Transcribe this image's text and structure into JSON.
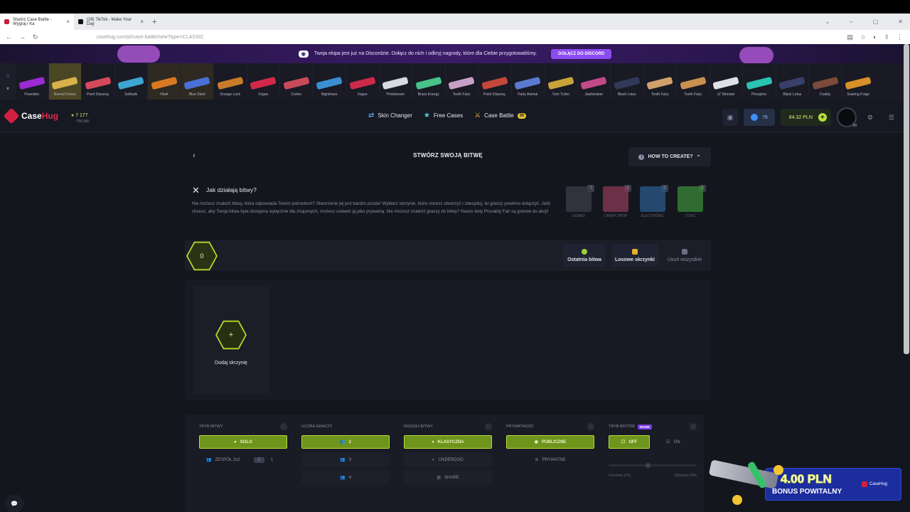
{
  "browser": {
    "tabs": [
      {
        "title": "Stwórz Case Battle - Wygraj i Ka"
      },
      {
        "title": "(28) TikTok - Make Your Day"
      }
    ],
    "new_tab": "+",
    "url": "casehug.com/pl/case-battle/new?type=CLASSIC"
  },
  "banner": {
    "text": "Twoja ekipa jest już na Discordzie. Dołącz do nich i odkryj nagrody, które dla Ciebie przygotowaliśmy.",
    "button": "DOŁĄCZ DO DISCORD"
  },
  "drops": [
    {
      "name": "Poseidon",
      "color": "#9b2ad1"
    },
    {
      "name": "Boreal Forest",
      "color": "#d7b24a"
    },
    {
      "name": "Point Disarray",
      "color": "#d44a5a"
    },
    {
      "name": "Solitude",
      "color": "#3fa5d2"
    },
    {
      "name": "Howl",
      "color": "#d97a22"
    },
    {
      "name": "Blue Steel",
      "color": "#4a6fd8"
    },
    {
      "name": "Orange Lock",
      "color": "#c87b2a"
    },
    {
      "name": "Vogue",
      "color": "#d2294b"
    },
    {
      "name": "Cortex",
      "color": "#c84a5a"
    },
    {
      "name": "Nightmare",
      "color": "#3a8fd2"
    },
    {
      "name": "Vogue",
      "color": "#cc2a48"
    },
    {
      "name": "Printstream",
      "color": "#d9d9e0"
    },
    {
      "name": "Brass Energy",
      "color": "#48c28a"
    },
    {
      "name": "Tooth Fairy",
      "color": "#c7a0c8"
    },
    {
      "name": "Point Disarray",
      "color": "#c4483a"
    },
    {
      "name": "Party Animal",
      "color": "#5a7ad2"
    },
    {
      "name": "Twin Turbo",
      "color": "#c9a23a"
    },
    {
      "name": "Jawbreaker",
      "color": "#c24a8a"
    },
    {
      "name": "Black Lotus",
      "color": "#2f3a5a"
    },
    {
      "name": "Tooth Fairy",
      "color": "#d2a06a"
    },
    {
      "name": "Tooth Fairy",
      "color": "#c99050"
    },
    {
      "name": "Lil' Monster",
      "color": "#e0e0e8"
    },
    {
      "name": "Phosphor",
      "color": "#2ac2b0"
    },
    {
      "name": "Black Lotus",
      "color": "#3a3f6a"
    },
    {
      "name": "Duality",
      "color": "#7a4a3a"
    },
    {
      "name": "Soaring Forge",
      "color": "#d8902a"
    }
  ],
  "header": {
    "logo_a": "Case",
    "logo_b": "Hug",
    "online_count": "7 177",
    "online_label": "ONLINE",
    "nav": [
      {
        "icon": "⇄",
        "label": "Skin Changer"
      },
      {
        "icon": "★",
        "label": "Free Cases"
      },
      {
        "icon": "⚔",
        "label": "Case Battle",
        "badge": "30"
      }
    ],
    "coins": "78",
    "balance": "84.32 PLN",
    "plus": "+",
    "level": "20"
  },
  "page": {
    "title": "STWÓRZ SWOJĄ BITWĘ",
    "how_to": "HOW TO CREATE?",
    "back": "‹"
  },
  "info": {
    "title": "Jak działają bitwy?",
    "description": "Nie możesz znaleźć bitwy, która odpowiada Twoim potrzebom? Stworzenie jej jest bardzo proste! Wybierz skrzynie, które chcesz otworzyć i zdecyduj, ilu graczy powinno dołączyć. Jeśli chcesz, aby Twoja bitwa była dostępna wyłącznie dla znajomych, możesz ustawić ją jako prywatną. Nie możesz znaleźć graczy do bitwy? Nasze boty Provably Fair są gotowe do akcji!",
    "cases": [
      {
        "name": "GUARD",
        "tag": "$",
        "color": "#3a3d4a"
      },
      {
        "name": "CANDY DROP",
        "tag": "$",
        "color": "#8a3a55"
      },
      {
        "name": "ELECTRONIC",
        "tag": "$",
        "color": "#2a5a8a"
      },
      {
        "name": "TOXIC",
        "tag": "$",
        "color": "#3a8a3a"
      }
    ]
  },
  "battle_bar": {
    "count": "0",
    "last_battle": "Ostatnia bitwa",
    "random_cases": "Losowe skrzynki",
    "remove_all": "Usuń wszystkie"
  },
  "add_case": {
    "plus": "+",
    "label": "Dodaj skrzynię"
  },
  "settings": {
    "mode": {
      "header": "TRYB BITWY",
      "options": [
        "SOLO",
        "ZESPÓŁ 2x2"
      ],
      "team_values": [
        "2",
        "1"
      ]
    },
    "players": {
      "header": "LICZBA GRACZY",
      "options": [
        "2",
        "3",
        "4"
      ]
    },
    "type": {
      "header": "RODZAJ BITWY",
      "options": [
        "KLASYCZNA",
        "UNDERDOG",
        "SHARE"
      ]
    },
    "privacy": {
      "header": "PRYWATNOŚĆ",
      "options": [
        "PUBLICZNE",
        "PRYWATNE"
      ]
    },
    "bots": {
      "header": "TRYB BOTÓW",
      "badge": "NOWE",
      "off": "OFF",
      "on": "ON",
      "slider_left": "Ochotnie 10%",
      "slider_right": "Odmowa 90%"
    }
  },
  "bonus": {
    "amount": "4.00 PLN",
    "label": "BONUS POWITALNY",
    "brand": "CaseHug"
  },
  "chat": "💬"
}
